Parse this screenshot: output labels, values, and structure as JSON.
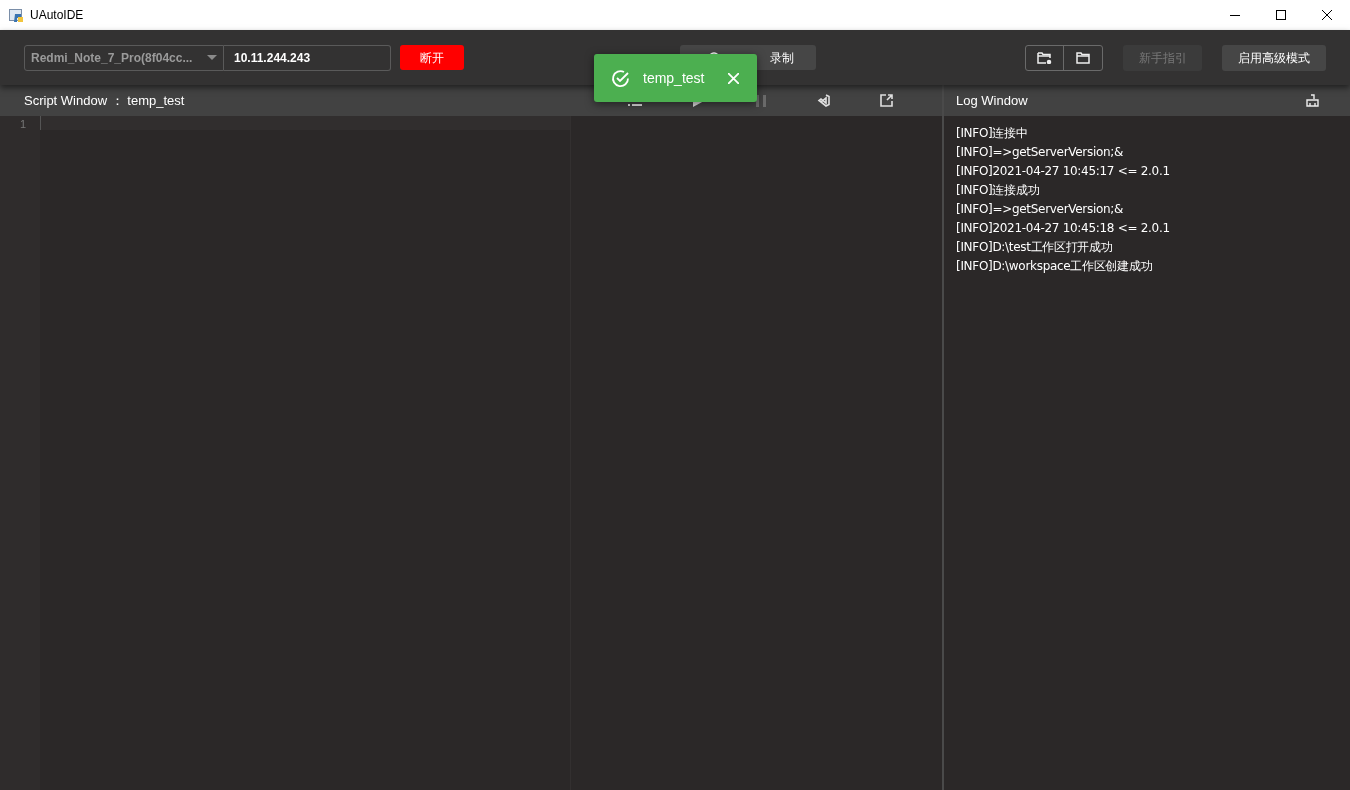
{
  "window": {
    "title": "UAutoIDE"
  },
  "toolbar": {
    "device_select": {
      "value": "Redmi_Note_7_Pro(8f04cc..."
    },
    "ip_field": {
      "value": "10.11.244.243"
    },
    "disconnect_button": "断开",
    "record_button": "录制",
    "guide_button": {
      "label": "新手指引",
      "disabled": true
    },
    "advanced_button": {
      "label": "启用高级模式",
      "disabled": false
    }
  },
  "toast": {
    "message": "temp_test"
  },
  "script_window": {
    "title": "Script Window ： temp_test",
    "tools": [
      {
        "kind": "list",
        "disabled": false
      },
      {
        "kind": "play",
        "disabled": false
      },
      {
        "kind": "pause",
        "disabled": true
      },
      {
        "kind": "vscode",
        "disabled": false
      },
      {
        "kind": "export",
        "disabled": false
      }
    ],
    "line_numbers": [
      "1"
    ]
  },
  "log_window": {
    "title": "Log Window",
    "lines": [
      "[INFO]连接中",
      "[INFO]=>getServerVersion;&",
      "[INFO]2021-04-27 10:45:17 <= 2.0.1",
      "[INFO]连接成功",
      "[INFO]=>getServerVersion;&",
      "[INFO]2021-04-27 10:45:18 <= 2.0.1",
      "[INFO]D:\\test工作区打开成功",
      "[INFO]D:\\workspace工作区创建成功"
    ]
  }
}
